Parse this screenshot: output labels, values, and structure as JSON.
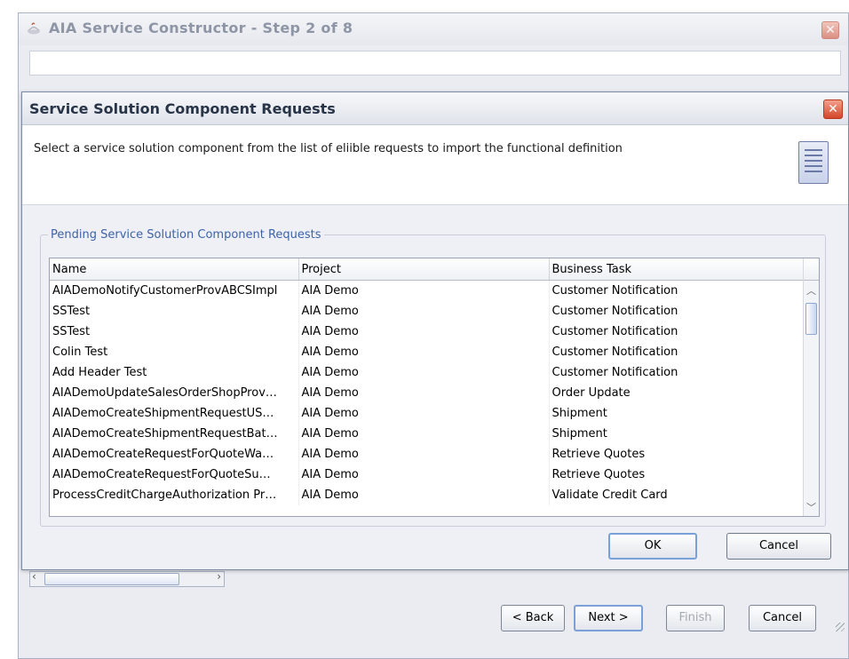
{
  "outer_window": {
    "title": "AIA Service Constructor - Step 2 of 8",
    "close_label": "✕",
    "buttons": {
      "back": "< Back",
      "next": "Next >",
      "finish": "Finish",
      "cancel": "Cancel"
    }
  },
  "dialog": {
    "title": "Service Solution Component Requests",
    "close_label": "✕",
    "instructions": "Select a service solution component from the list of eliible requests to import the functional definition",
    "group_title": "Pending Service Solution Component Requests",
    "table": {
      "columns": [
        "Name",
        "Project",
        "Business Task"
      ],
      "rows": [
        [
          "AIADemoNotifyCustomerProvABCSImpl",
          "AIA Demo",
          "Customer Notification"
        ],
        [
          "SSTest",
          "AIA Demo",
          "Customer Notification"
        ],
        [
          "SSTest",
          "AIA Demo",
          "Customer Notification"
        ],
        [
          "Colin Test",
          "AIA Demo",
          "Customer Notification"
        ],
        [
          "Add Header Test",
          "AIA Demo",
          "Customer Notification"
        ],
        [
          "AIADemoUpdateSalesOrderShopProv…",
          "AIA Demo",
          "Order Update"
        ],
        [
          "AIADemoCreateShipmentRequestUS…",
          "AIA Demo",
          "Shipment"
        ],
        [
          "AIADemoCreateShipmentRequestBat…",
          "AIA Demo",
          "Shipment"
        ],
        [
          "AIADemoCreateRequestForQuoteWa…",
          "AIA Demo",
          "Retrieve Quotes"
        ],
        [
          "AIADemoCreateRequestForQuoteSu…",
          "AIA Demo",
          "Retrieve Quotes"
        ],
        [
          "ProcessCreditChargeAuthorization Pr…",
          "AIA Demo",
          "Validate Credit Card"
        ]
      ]
    },
    "buttons": {
      "ok": "OK",
      "cancel": "Cancel"
    }
  }
}
